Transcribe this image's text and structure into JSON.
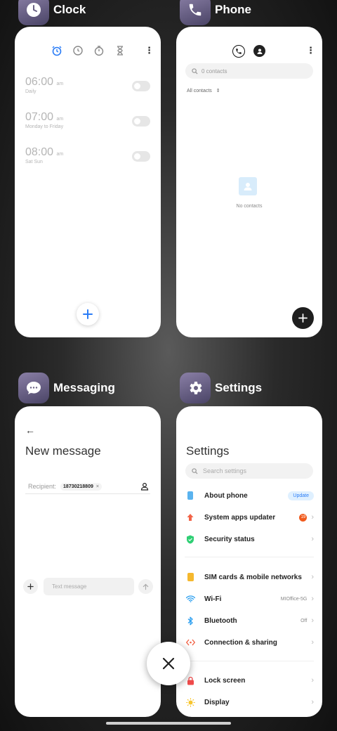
{
  "apps": {
    "clock": {
      "title": "Clock",
      "alarms": [
        {
          "time": "06:00",
          "ampm": "am",
          "repeat": "Daily"
        },
        {
          "time": "07:00",
          "ampm": "am",
          "repeat": "Monday to Friday"
        },
        {
          "time": "08:00",
          "ampm": "am",
          "repeat": "Sat Sun"
        }
      ]
    },
    "phone": {
      "title": "Phone",
      "search_placeholder": "0 contacts",
      "filter_label": "All contacts",
      "empty_label": "No contacts"
    },
    "messaging": {
      "title": "Messaging",
      "heading": "New message",
      "recipient_label": "Recipient:",
      "recipient_value": "18730218809",
      "text_placeholder": "Text message"
    },
    "settings": {
      "title": "Settings",
      "heading": "Settings",
      "search_placeholder": "Search settings",
      "rows": [
        {
          "label": "About phone",
          "badge": "Update"
        },
        {
          "label": "System apps updater",
          "count": "19"
        },
        {
          "label": "Security status"
        },
        {
          "label": "SIM cards & mobile networks"
        },
        {
          "label": "Wi-Fi",
          "value": "MIOffice-5G"
        },
        {
          "label": "Bluetooth",
          "value": "Off"
        },
        {
          "label": "Connection & sharing"
        },
        {
          "label": "Lock screen"
        },
        {
          "label": "Display"
        }
      ]
    }
  },
  "colors": {
    "accent_blue": "#2a7cf6",
    "update_badge_bg": "#dff0ff",
    "count_badge": "#f05a1c"
  }
}
